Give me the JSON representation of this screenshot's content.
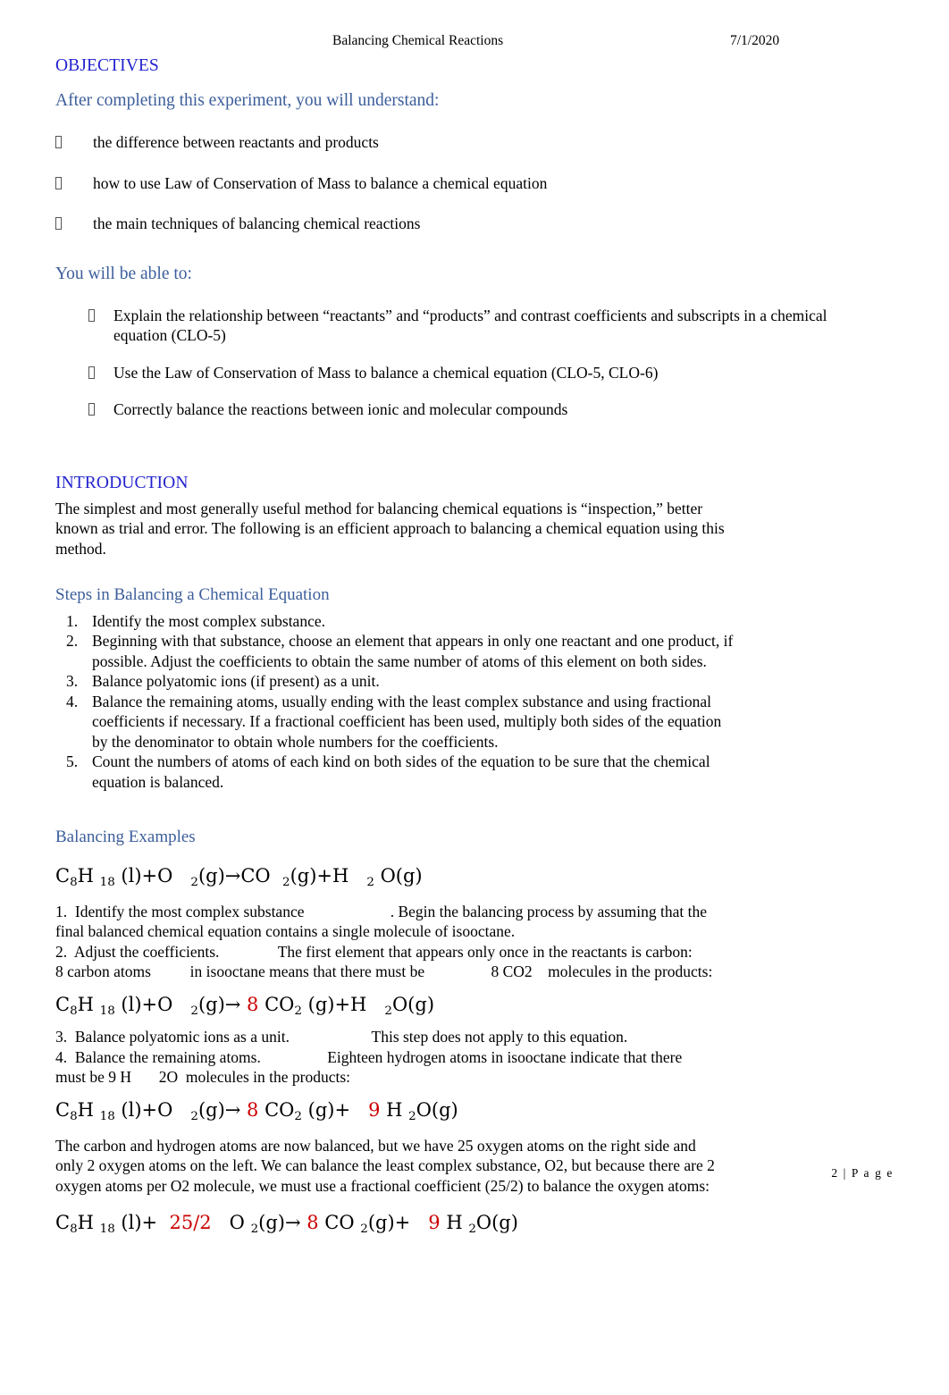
{
  "header": {
    "doc_title": "Balancing Chemical Reactions",
    "date": "7/1/2020"
  },
  "objectives": {
    "heading": "OBJECTIVES",
    "subheading": "After completing this experiment, you will understand:",
    "items": [
      "the difference between reactants and products",
      "how to use Law of Conservation of Mass to balance a chemical equation",
      "the main techniques of balancing chemical reactions"
    ],
    "able_to_heading": "You will be able to:",
    "able_to_items": [
      "Explain the relationship between “reactants” and “products” and contrast coefficients and subscripts in a chemical equation  (CLO-5)",
      "Use the Law of Conservation of Mass to balance a chemical equation (CLO-5, CLO-6)",
      "Correctly balance the reactions between ionic and molecular compounds"
    ]
  },
  "introduction": {
    "heading": "INTRODUCTION",
    "paragraph": "The simplest and most generally useful method for balancing chemical equations is “inspection,” better known as trial and error. The following is an efficient approach to balancing a chemical equation using this method."
  },
  "steps_section": {
    "heading": "Steps in Balancing a Chemical Equation",
    "steps": [
      "Identify the most complex substance.",
      "Beginning with that substance, choose an element that appears in only one reactant and one product, if possible. Adjust the coefficients to obtain the same number of atoms of this element on both sides.",
      "Balance polyatomic ions (if present) as a unit.",
      "Balance the remaining atoms, usually ending with the least complex substance and using fractional coefficients if necessary. If a fractional coefficient has been used, multiply both sides of the equation by the denominator to obtain whole numbers for the coefficients.",
      "Count the numbers of atoms of each kind on both sides of the equation to be sure that the chemical equation is balanced."
    ]
  },
  "examples": {
    "heading": "Balancing Examples",
    "equation1": {
      "parts": [
        {
          "text": "C",
          "red": false
        },
        {
          "text": "8",
          "sub": true,
          "red": false
        },
        {
          "text": "H ",
          "red": false
        },
        {
          "text": "18",
          "sub": true,
          "red": false
        },
        {
          "text": " (l)+O   ",
          "red": false
        },
        {
          "text": "2",
          "sub": true,
          "red": false
        },
        {
          "text": "(g)→CO  ",
          "red": false
        },
        {
          "text": "2",
          "sub": true,
          "red": false
        },
        {
          "text": "(g)+H   ",
          "red": false
        },
        {
          "text": "2",
          "sub": true,
          "red": false
        },
        {
          "text": " O(g)",
          "red": false
        }
      ],
      "plain": "C8H18 (l)+O 2(g)→CO 2(g)+H 2 O(g)"
    },
    "step1_line1": "1.  Identify the most complex substance                      . Begin the balancing process by assuming that the",
    "step1_line2": "final balanced chemical equation contains a single molecule of isooctane.",
    "step2_line1": "2.  Adjust the coefficients.               The first element that appears only once in the reactants is carbon:",
    "step2_line2": "8 carbon atoms          in isooctane means that there must be                 8 CO2    molecules in the products:",
    "equation2": {
      "parts": [
        {
          "text": "C",
          "red": false
        },
        {
          "text": "8",
          "sub": true,
          "red": false
        },
        {
          "text": "H ",
          "red": false
        },
        {
          "text": "18",
          "sub": true,
          "red": false
        },
        {
          "text": " (l)+O   ",
          "red": false
        },
        {
          "text": "2",
          "sub": true,
          "red": false
        },
        {
          "text": "(g)→ ",
          "red": false
        },
        {
          "text": "8",
          "red": true
        },
        {
          "text": " CO",
          "red": false
        },
        {
          "text": "2",
          "sub": true,
          "red": false
        },
        {
          "text": " (g)+H   ",
          "red": false
        },
        {
          "text": "2",
          "sub": true,
          "red": false
        },
        {
          "text": "O(g)",
          "red": false
        }
      ],
      "plain": "C8H18 (l)+O 2(g)→ 8 CO2 (g)+H 2O(g)"
    },
    "step3_line": "3.  Balance polyatomic ions as a unit.                     This step does not apply to this equation.",
    "step4_line1": "4.  Balance the remaining atoms.                 Eighteen hydrogen atoms in isooctane indicate that there",
    "step4_line2": "must be 9 H       2O  molecules in the products:",
    "equation3": {
      "parts": [
        {
          "text": "C",
          "red": false
        },
        {
          "text": "8",
          "sub": true,
          "red": false
        },
        {
          "text": "H ",
          "red": false
        },
        {
          "text": "18",
          "sub": true,
          "red": false
        },
        {
          "text": " (l)+O   ",
          "red": false
        },
        {
          "text": "2",
          "sub": true,
          "red": false
        },
        {
          "text": "(g)→ ",
          "red": false
        },
        {
          "text": "8",
          "red": true
        },
        {
          "text": " CO",
          "red": false
        },
        {
          "text": "2",
          "sub": true,
          "red": false
        },
        {
          "text": " (g)+   ",
          "red": false
        },
        {
          "text": "9",
          "red": true
        },
        {
          "text": " H ",
          "red": false
        },
        {
          "text": "2",
          "sub": true,
          "red": false
        },
        {
          "text": "O(g)",
          "red": false
        }
      ],
      "plain": "C8H18 (l)+O 2(g)→ 8 CO2 (g)+ 9 H 2O(g)"
    },
    "closing_paragraph": "The carbon and hydrogen atoms are now balanced, but we have 25 oxygen atoms on the right side and only 2 oxygen atoms on the left. We can balance the least complex substance, O2, but because there are 2 oxygen atoms per O2 molecule, we must use a fractional coefficient (25/2) to balance the oxygen atoms:",
    "equation4": {
      "parts": [
        {
          "text": "C",
          "red": false
        },
        {
          "text": "8",
          "sub": true,
          "red": false
        },
        {
          "text": "H ",
          "red": false
        },
        {
          "text": "18",
          "sub": true,
          "red": false
        },
        {
          "text": " (l)+  ",
          "red": false
        },
        {
          "text": "25/2",
          "red": true
        },
        {
          "text": "   O ",
          "red": false
        },
        {
          "text": "2",
          "sub": true,
          "red": false
        },
        {
          "text": "(g)→ ",
          "red": false
        },
        {
          "text": "8",
          "red": true
        },
        {
          "text": " CO ",
          "red": false
        },
        {
          "text": "2",
          "sub": true,
          "red": false
        },
        {
          "text": "(g)+   ",
          "red": false
        },
        {
          "text": "9",
          "red": true
        },
        {
          "text": " H ",
          "red": false
        },
        {
          "text": "2",
          "sub": true,
          "red": false
        },
        {
          "text": "O(g)",
          "red": false
        }
      ],
      "plain": "C8H18 (l)+ 25/2  O 2(g)→ 8 CO 2(g)+ 9 H 2O(g)"
    }
  },
  "footer": {
    "page_marker": "2 | P a g e"
  },
  "colors": {
    "heading_blue": "#2323CF",
    "heading_steel": "#3C5E9B",
    "coefficient_red": "#CC0000",
    "body_black": "#000000"
  }
}
